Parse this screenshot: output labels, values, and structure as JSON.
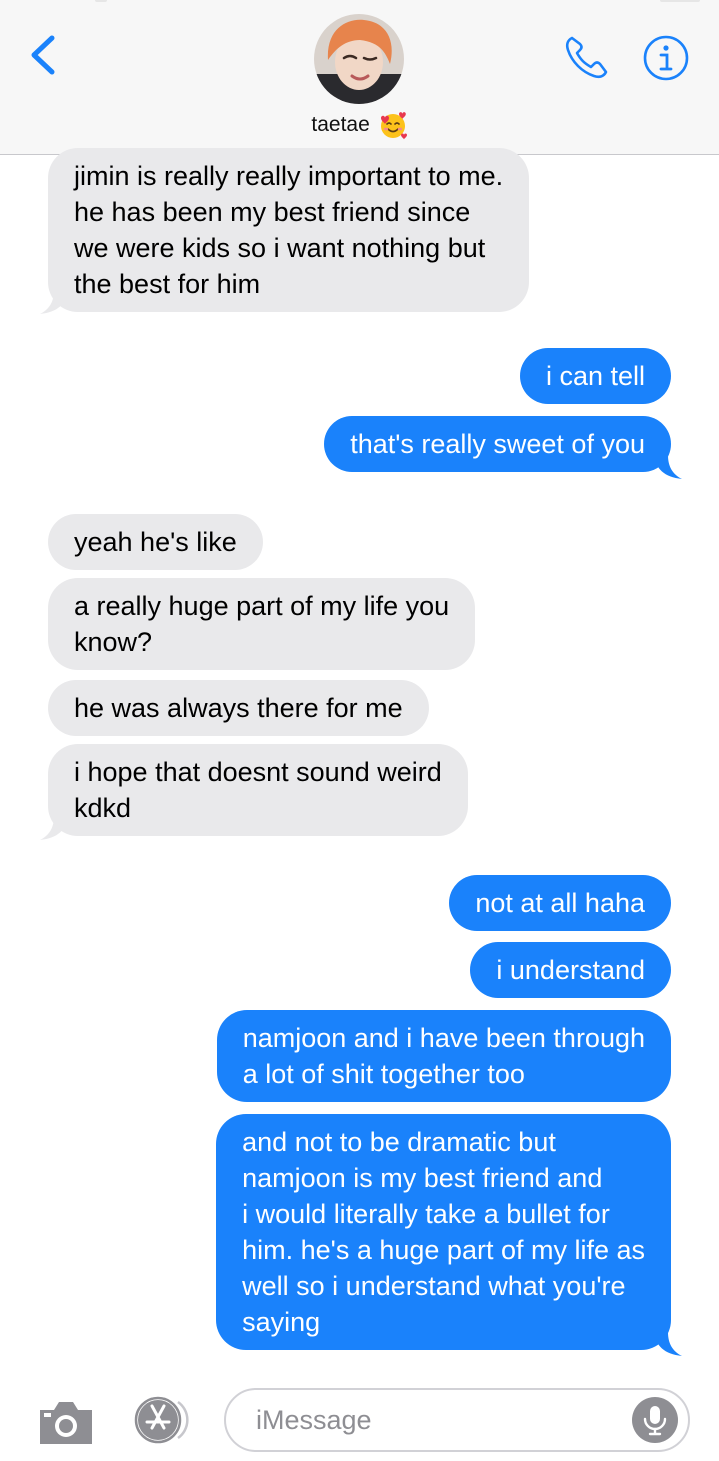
{
  "header": {
    "contact_name": "taetae",
    "contact_emoji": "smiling-face-with-hearts",
    "back_icon": "chevron-left",
    "call_icon": "phone-icon",
    "info_icon": "info-icon",
    "accent_color": "#1a82fb"
  },
  "messages": [
    {
      "from": "them",
      "text": "jimin is really really important to me.\nhe has been my best friend since\nwe were kids so i want nothing but\nthe best for him"
    },
    {
      "from": "me",
      "text": "i can tell"
    },
    {
      "from": "me",
      "text": "that's really sweet of you"
    },
    {
      "from": "them",
      "text": "yeah he's like"
    },
    {
      "from": "them",
      "text": "a really huge part of my life you\nknow?"
    },
    {
      "from": "them",
      "text": "he was always there for me"
    },
    {
      "from": "them",
      "text": "i hope that doesnt sound weird\nkdkd"
    },
    {
      "from": "me",
      "text": "not at all haha"
    },
    {
      "from": "me",
      "text": "i understand"
    },
    {
      "from": "me",
      "text": "namjoon and i have been through\na lot of shit together too"
    },
    {
      "from": "me",
      "text": "and not to be dramatic but\nnamjoon is my best friend and\ni would literally take a bullet for\nhim. he's a huge part of my life as\nwell so i understand what you're\nsaying"
    }
  ],
  "input_bar": {
    "placeholder": "iMessage",
    "camera_icon": "camera-icon",
    "apps_icon": "app-store-icon",
    "mic_icon": "microphone-icon"
  },
  "colors": {
    "sent_bubble": "#1a82fb",
    "received_bubble": "#e9e9eb",
    "header_bg": "#f7f7f7"
  }
}
